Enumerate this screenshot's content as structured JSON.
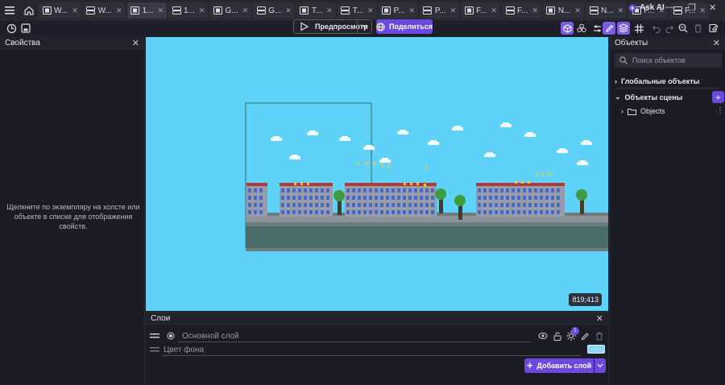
{
  "tabs": [
    {
      "label": "W...",
      "icon": "scene-icon"
    },
    {
      "label": "W...",
      "icon": "layout-icon"
    },
    {
      "label": "1...",
      "icon": "scene-icon",
      "active": true
    },
    {
      "label": "1...",
      "icon": "layout-icon"
    },
    {
      "label": "G...",
      "icon": "scene-icon"
    },
    {
      "label": "G...",
      "icon": "layout-icon"
    },
    {
      "label": "T...",
      "icon": "scene-icon"
    },
    {
      "label": "T...",
      "icon": "layout-icon"
    },
    {
      "label": "P...",
      "icon": "scene-icon"
    },
    {
      "label": "P...",
      "icon": "layout-icon"
    },
    {
      "label": "F...",
      "icon": "scene-icon"
    },
    {
      "label": "F...",
      "icon": "layout-icon"
    },
    {
      "label": "N...",
      "icon": "scene-icon"
    },
    {
      "label": "N...",
      "icon": "layout-icon"
    },
    {
      "label": "F...",
      "icon": "scene-icon"
    },
    {
      "label": "F...",
      "icon": "layout-icon"
    }
  ],
  "header": {
    "ask_ai": "Ask AI"
  },
  "toolbar": {
    "preview_label": "Предпросмотр",
    "share_label": "Поделиться"
  },
  "properties": {
    "title": "Свойства",
    "hint": "Щелкните по экземпляру на холсте или объекте в списке для отображения свойств."
  },
  "canvas": {
    "coords": "819;413",
    "background_color": "#5ed2f9"
  },
  "objects": {
    "title": "Объекты",
    "search_placeholder": "Поиск объектов",
    "global_objects": "Глобальные объекты",
    "scene_objects": "Объекты сцены",
    "folder": "Objects"
  },
  "layers": {
    "title": "Слои",
    "base_layer": "Основной слой",
    "background_color_label": "Цвет фона",
    "effects_count": "1",
    "add_layer": "Добавить слой",
    "bg_swatch": "#8ed8f4"
  },
  "colors": {
    "accent": "#6b48e0",
    "panel": "#1c1c25"
  }
}
